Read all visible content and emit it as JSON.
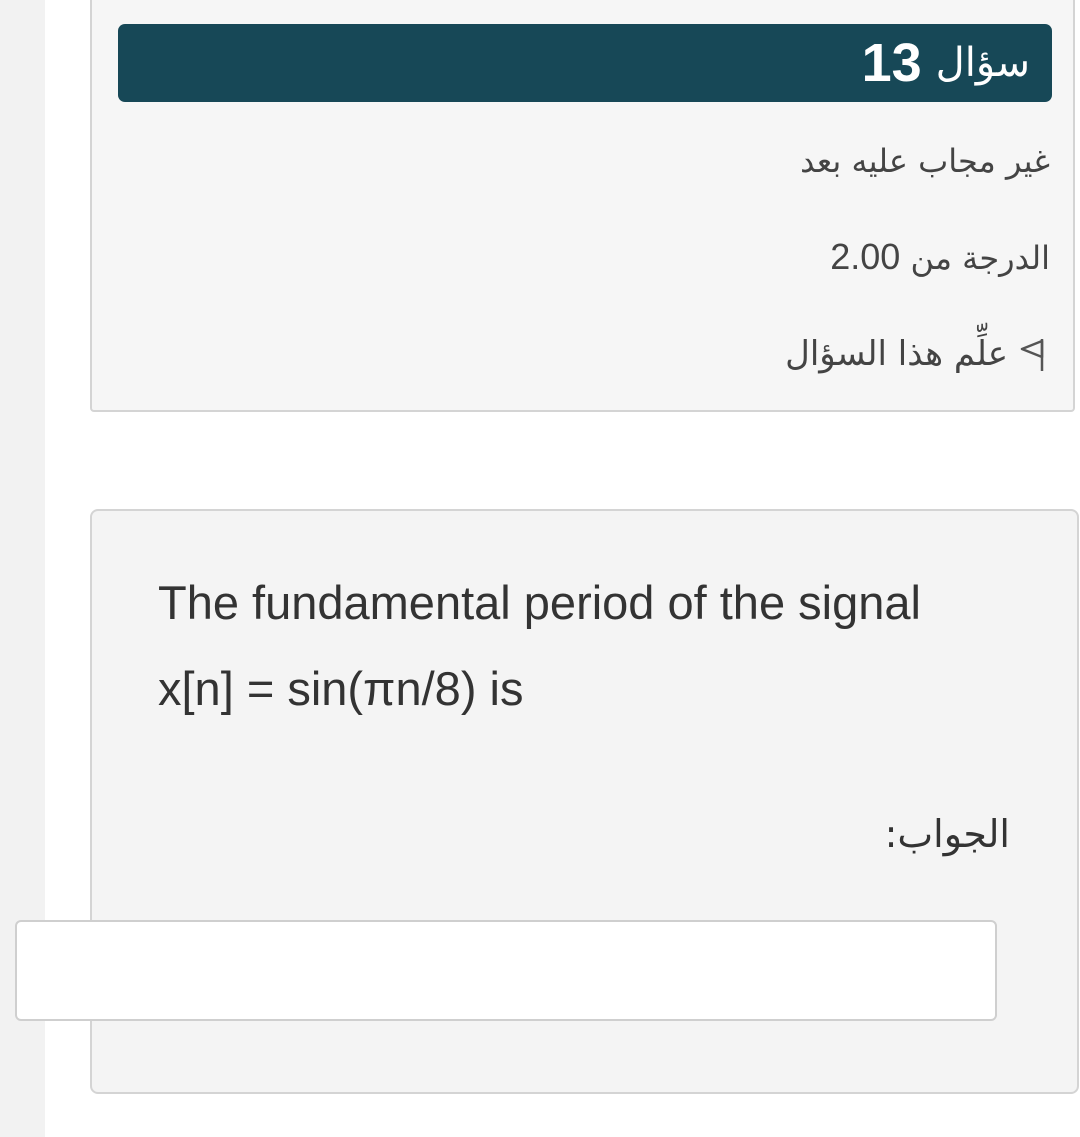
{
  "question": {
    "label": "سؤال",
    "number": "13",
    "state": "غير مجاب عليه بعد",
    "grade_label": "الدرجة من",
    "grade_value": "2.00",
    "flag_label": "علِّم هذا السؤال",
    "flag_icon": "flag-icon",
    "text_line1": "The fundamental period of the signal",
    "text_line2": "x[n] = sin(πn/8)  is",
    "answer_label": "الجواب:",
    "answer_value": ""
  },
  "colors": {
    "header_bg": "#174857",
    "header_text": "#ffffff",
    "panel_bg": "#f4f4f4",
    "panel_border": "#d4d4d4"
  }
}
